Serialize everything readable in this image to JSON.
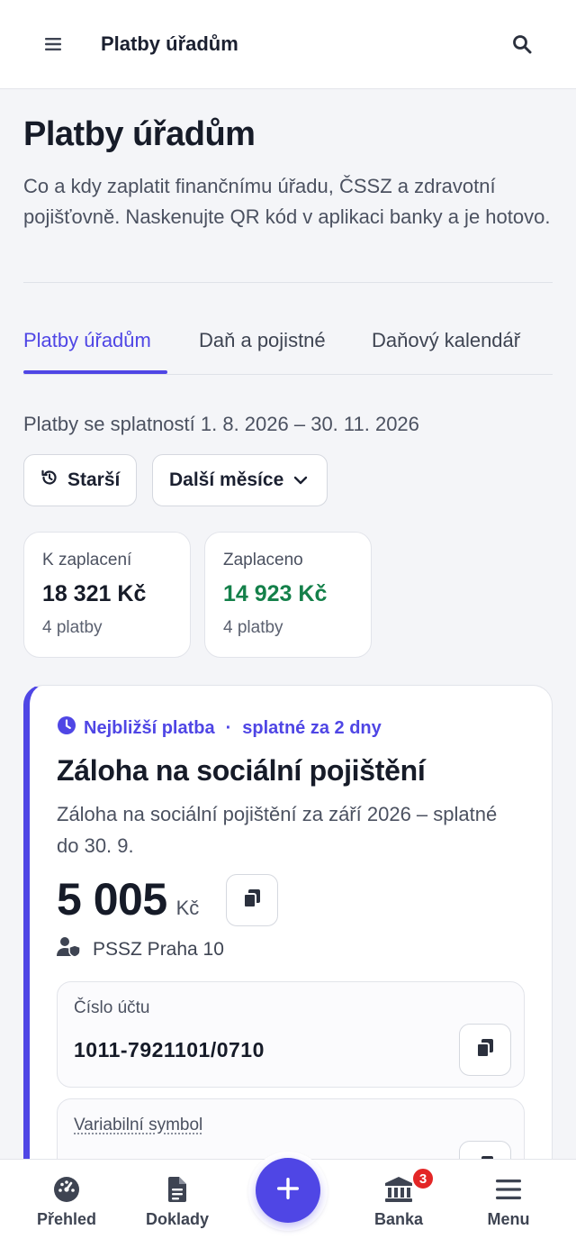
{
  "app_bar": {
    "title": "Platby úřadům",
    "menu_icon": "hamburger-icon",
    "search_icon": "search-icon"
  },
  "header": {
    "title": "Platby úřadům",
    "description": "Co a kdy zaplatit finančnímu úřadu, ČSSZ a zdravotní pojišťovně. Naskenujte QR kód v aplikaci banky a je hotovo."
  },
  "tabs": [
    {
      "label": "Platby úřadům",
      "active": true
    },
    {
      "label": "Daň a pojistné",
      "active": false
    },
    {
      "label": "Daňový kalendář",
      "active": false
    }
  ],
  "range": {
    "text": "Platby se splatností 1. 8. 2026 – 30. 11. 2026"
  },
  "filters": {
    "older_label": "Starší",
    "older_icon": "history-icon",
    "next_label": "Další měsíce",
    "next_icon": "chevron-down-icon"
  },
  "summary": {
    "to_pay": {
      "label": "K zaplacení",
      "amount": "18 321 Kč",
      "count": "4 platby"
    },
    "paid": {
      "label": "Zaplaceno",
      "amount": "14 923 Kč",
      "count": "4 platby"
    }
  },
  "next_payment": {
    "badge_label": "Nejbližší platba",
    "separator": "·",
    "due_label": "splatné za 2 dny",
    "title": "Záloha na sociální pojištění",
    "description": "Záloha na sociální pojištění za září 2026 – splatné do 30. 9.",
    "amount": "5 005",
    "currency": "Kč",
    "office": "PSSZ Praha 10",
    "account_label": "Číslo účtu",
    "account_value": "1011-7921101/0710",
    "vs_label": "Variabilní symbol"
  },
  "bottom_nav": {
    "items": [
      {
        "label": "Přehled",
        "icon": "gauge-icon"
      },
      {
        "label": "Doklady",
        "icon": "document-icon"
      },
      {
        "label": "Banka",
        "icon": "bank-icon",
        "badge": "3"
      },
      {
        "label": "Menu",
        "icon": "hamburger-icon"
      }
    ],
    "fab_icon": "plus-icon"
  },
  "colors": {
    "accent": "#4f46e5",
    "paid_green": "#14804a",
    "badge_red": "#e32626",
    "text_dark": "#161b28"
  }
}
